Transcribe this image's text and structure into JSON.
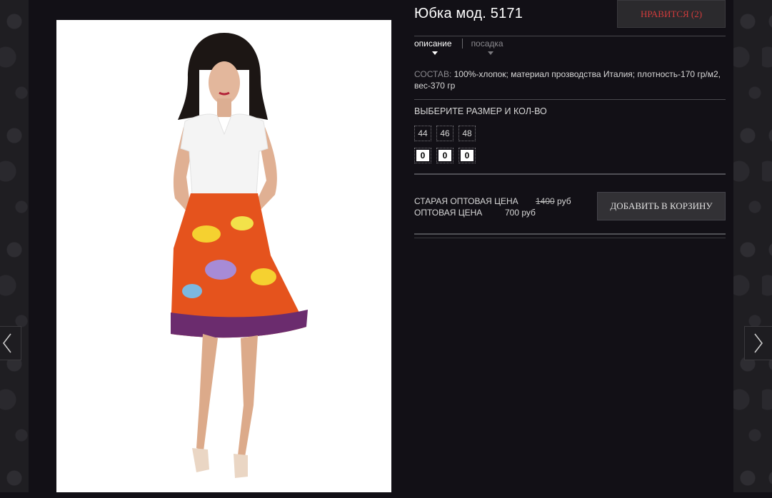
{
  "product": {
    "title": "Юбка мод. 5171",
    "like_label": "НРАВИТСЯ (2)"
  },
  "tabs": [
    {
      "label": "описание",
      "active": true
    },
    {
      "label": "посадка",
      "active": false
    }
  ],
  "composition": {
    "label": "СОСТАВ:",
    "text": "100%-хлопок; материал прозводства Италия; плотность-170 гр/м2, вес-370 гр"
  },
  "sizes": {
    "title": "ВЫБЕРИТЕ РАЗМЕР И КОЛ-ВО",
    "items": [
      {
        "size": "44",
        "qty": "0"
      },
      {
        "size": "46",
        "qty": "0"
      },
      {
        "size": "48",
        "qty": "0"
      }
    ]
  },
  "prices": {
    "old_label": "СТАРАЯ ОПТОВАЯ ЦЕНА",
    "old_value": "1400",
    "old_currency": "руб",
    "label": "ОПТОВАЯ ЦЕНА",
    "value": "700 руб"
  },
  "cart_button_label": "ДОБАВИТЬ В КОРЗИНУ",
  "nav": {
    "prev_icon": "chevron-left-icon",
    "next_icon": "chevron-right-icon"
  },
  "colors": {
    "background": "#121016",
    "like_text": "#d23c3c",
    "button_bg": "#323135"
  }
}
